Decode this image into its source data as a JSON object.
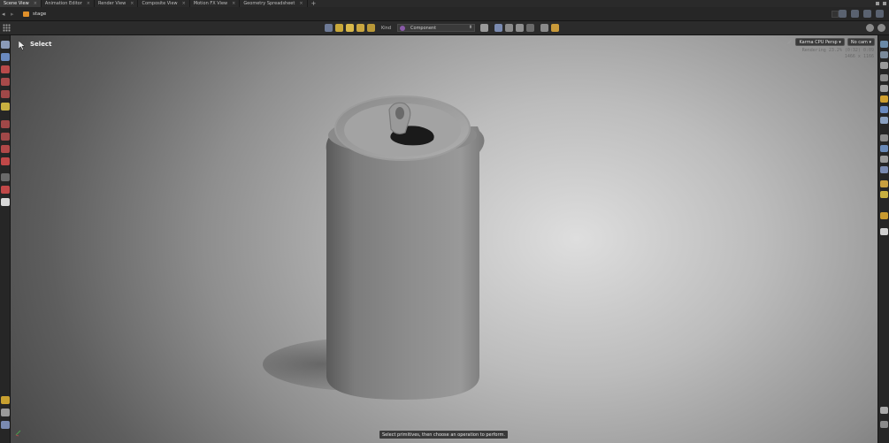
{
  "tabs": [
    {
      "label": "Scene View",
      "active": true
    },
    {
      "label": "Animation Editor",
      "active": false
    },
    {
      "label": "Render View",
      "active": false
    },
    {
      "label": "Composite View",
      "active": false
    },
    {
      "label": "Motion FX View",
      "active": false
    },
    {
      "label": "Geometry Spreadsheet",
      "active": false
    }
  ],
  "tab_close_glyph": "×",
  "tab_add_glyph": "+",
  "pathbar": {
    "back_glyph": "◂",
    "forward_glyph": "▸",
    "path": "stage",
    "stage_icon_color": "#e0902a"
  },
  "toolbar": {
    "kind_label": "Kind",
    "kind_value": "Component",
    "kind_arrow": "⬍"
  },
  "viewport": {
    "tool_label": "Select",
    "renderer": "Karma CPU  Persp ▾",
    "camera": "No cam ▾",
    "render_status": "Rendering  23.2%  (0:32)  0:09",
    "resolution": "1466 x 1166",
    "hint": "Select primitives, then choose an operation to perform."
  },
  "colors": {
    "accent_orange": "#e0902a",
    "hint_bg": "#3a3a3a"
  }
}
